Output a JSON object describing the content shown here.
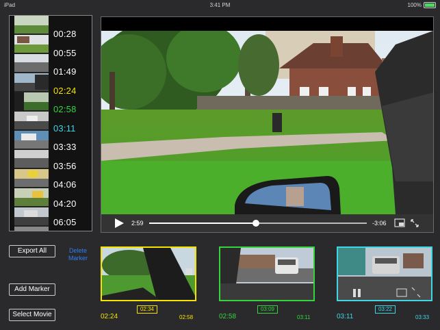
{
  "status_bar": {
    "device": "iPad",
    "time": "3:41 PM",
    "battery": "100%"
  },
  "marker_list": {
    "times": [
      {
        "label": "00:28",
        "color": "#ffffff"
      },
      {
        "label": "00:55",
        "color": "#ffffff"
      },
      {
        "label": "01:49",
        "color": "#ffffff"
      },
      {
        "label": "02:24",
        "color": "#f5e400"
      },
      {
        "label": "02:58",
        "color": "#34d63c"
      },
      {
        "label": "03:11",
        "color": "#3fd7e6"
      },
      {
        "label": "03:33",
        "color": "#ffffff"
      },
      {
        "label": "03:56",
        "color": "#ffffff"
      },
      {
        "label": "04:06",
        "color": "#ffffff"
      },
      {
        "label": "04:20",
        "color": "#ffffff"
      },
      {
        "label": "06:05",
        "color": "#ffffff"
      }
    ]
  },
  "player": {
    "current_time": "2:59",
    "remaining_time": "-3:06",
    "progress": 0.49
  },
  "buttons": {
    "export_all": "Export All",
    "delete_marker": "Delete Marker",
    "add_marker": "Add Marker",
    "select_movie": "Select Movie"
  },
  "clips": [
    {
      "start": "02:24",
      "marker": "02:34",
      "end": "02:58",
      "color": "#f5e400"
    },
    {
      "start": "02:58",
      "marker": "03:09",
      "end": "03:11",
      "color": "#34d63c"
    },
    {
      "start": "03:11",
      "marker": "03:22",
      "end": "03:33",
      "color": "#3fd7e6"
    }
  ]
}
